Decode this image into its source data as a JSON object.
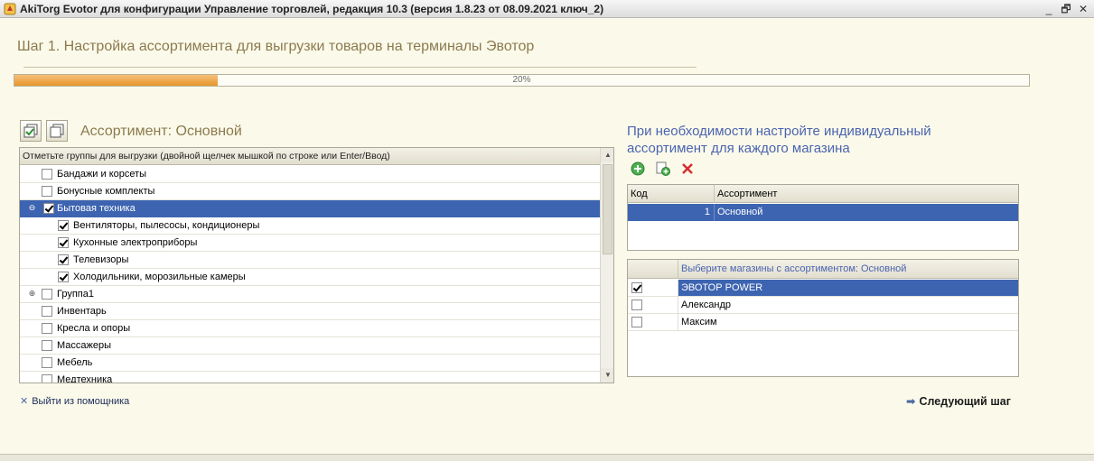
{
  "window": {
    "title": "AkiTorg Evotor для конфигурации Управление торговлей, редакция 10.3 (версия 1.8.23 от 08.09.2021 ключ_2)",
    "minimize_glyph": "_",
    "maximize_glyph": "🗗",
    "close_glyph": "✕"
  },
  "step": {
    "title": "Шаг 1. Настройка ассортимента для выгрузки товаров на терминалы Эвотор"
  },
  "progress": {
    "value_percent": 20,
    "label": "20%"
  },
  "assortment": {
    "title": "Ассортимент: Основной",
    "tree_header": "Отметьте группы для выгрузки (двойной щелчек мышкой по строке или Enter/Ввод)",
    "items": [
      {
        "label": "Бандажи и корсеты",
        "checked": false,
        "level": 0,
        "expander": ""
      },
      {
        "label": "Бонусные комплекты",
        "checked": false,
        "level": 0,
        "expander": ""
      },
      {
        "label": "Бытовая техника",
        "checked": true,
        "level": 0,
        "expander": "⊖",
        "selected": true
      },
      {
        "label": "Вентиляторы, пылесосы, кондиционеры",
        "checked": true,
        "level": 1,
        "expander": ""
      },
      {
        "label": "Кухонные электроприборы",
        "checked": true,
        "level": 1,
        "expander": ""
      },
      {
        "label": "Телевизоры",
        "checked": true,
        "level": 1,
        "expander": ""
      },
      {
        "label": "Холодильники, морозильные камеры",
        "checked": true,
        "level": 1,
        "expander": ""
      },
      {
        "label": "Группа1",
        "checked": false,
        "level": 0,
        "expander": "⊕"
      },
      {
        "label": "Инвентарь",
        "checked": false,
        "level": 0,
        "expander": ""
      },
      {
        "label": "Кресла и опоры",
        "checked": false,
        "level": 0,
        "expander": ""
      },
      {
        "label": "Массажеры",
        "checked": false,
        "level": 0,
        "expander": ""
      },
      {
        "label": "Мебель",
        "checked": false,
        "level": 0,
        "expander": ""
      },
      {
        "label": "Медтехника",
        "checked": false,
        "level": 0,
        "expander": ""
      }
    ],
    "scroll_up": "▲",
    "scroll_down": "▼"
  },
  "right": {
    "hint": "При необходимости настройте индивидуальный ассортимент для каждого магазина",
    "assort_grid": {
      "col_code": "Код",
      "col_name": "Ассортимент",
      "rows": [
        {
          "code": "1",
          "name": "Основной"
        }
      ]
    },
    "stores_grid": {
      "header": "Выберите магазины с ассортиментом: Основной",
      "rows": [
        {
          "name": "ЭВОТОР POWER",
          "checked": true,
          "selected": true
        },
        {
          "name": "Александр",
          "checked": false
        },
        {
          "name": "Максим",
          "checked": false
        }
      ]
    }
  },
  "footer": {
    "exit_label": "Выйти из помощника",
    "exit_glyph": "✕",
    "next_label": "Следующий шаг",
    "next_glyph": "➡"
  },
  "colors": {
    "accent_blue": "#3d64b0",
    "title_olive": "#8c7a4e",
    "progress_orange": "#e8962c",
    "background": "#fbfaea"
  }
}
